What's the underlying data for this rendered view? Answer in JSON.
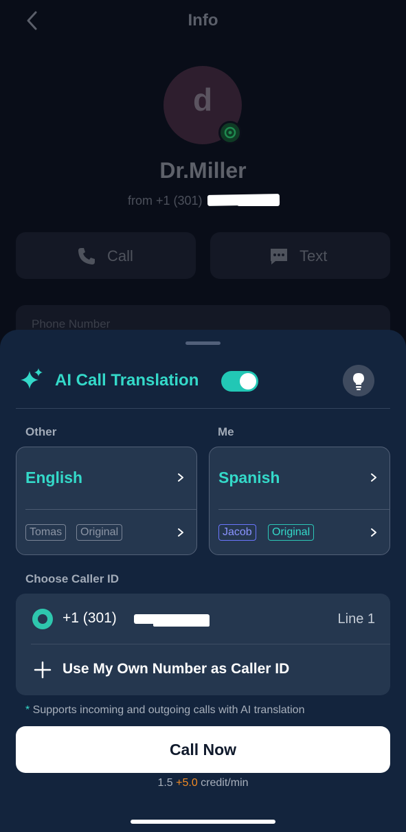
{
  "header": {
    "title": "Info",
    "back_icon": "chevron-left-icon"
  },
  "contact": {
    "avatar_letter": "d",
    "name": "Dr.Miller",
    "from_label": "from +1 (301)"
  },
  "actions": [
    {
      "label": "Call",
      "icon": "phone-icon"
    },
    {
      "label": "Text",
      "icon": "message-icon"
    }
  ],
  "phone_card": {
    "label": "Phone Number"
  },
  "sheet": {
    "title": "AI Call Translation",
    "translation_enabled": true,
    "tip_icon": "lightbulb-icon",
    "other": {
      "column_label": "Other",
      "language": "English",
      "tags": [
        "Tomas",
        "Original"
      ]
    },
    "me": {
      "column_label": "Me",
      "language": "Spanish",
      "tags": [
        "Jacob",
        "Original"
      ]
    },
    "caller_id": {
      "label": "Choose Caller ID",
      "number": "+1 (301)",
      "line": "Line 1",
      "own_number_label": "Use My Own Number as Caller ID"
    },
    "support_note": {
      "star": "*",
      "text": " Supports incoming and outgoing calls with AI translation"
    },
    "call_button_label": "Call Now",
    "rate": {
      "base": "1.5 ",
      "bonus": "+5.0",
      "unit": " credit/min"
    }
  },
  "colors": {
    "accent": "#34d9c9",
    "sheet_bg": "#13243d",
    "card_bg": "#25374f",
    "bonus": "#f08a24"
  }
}
